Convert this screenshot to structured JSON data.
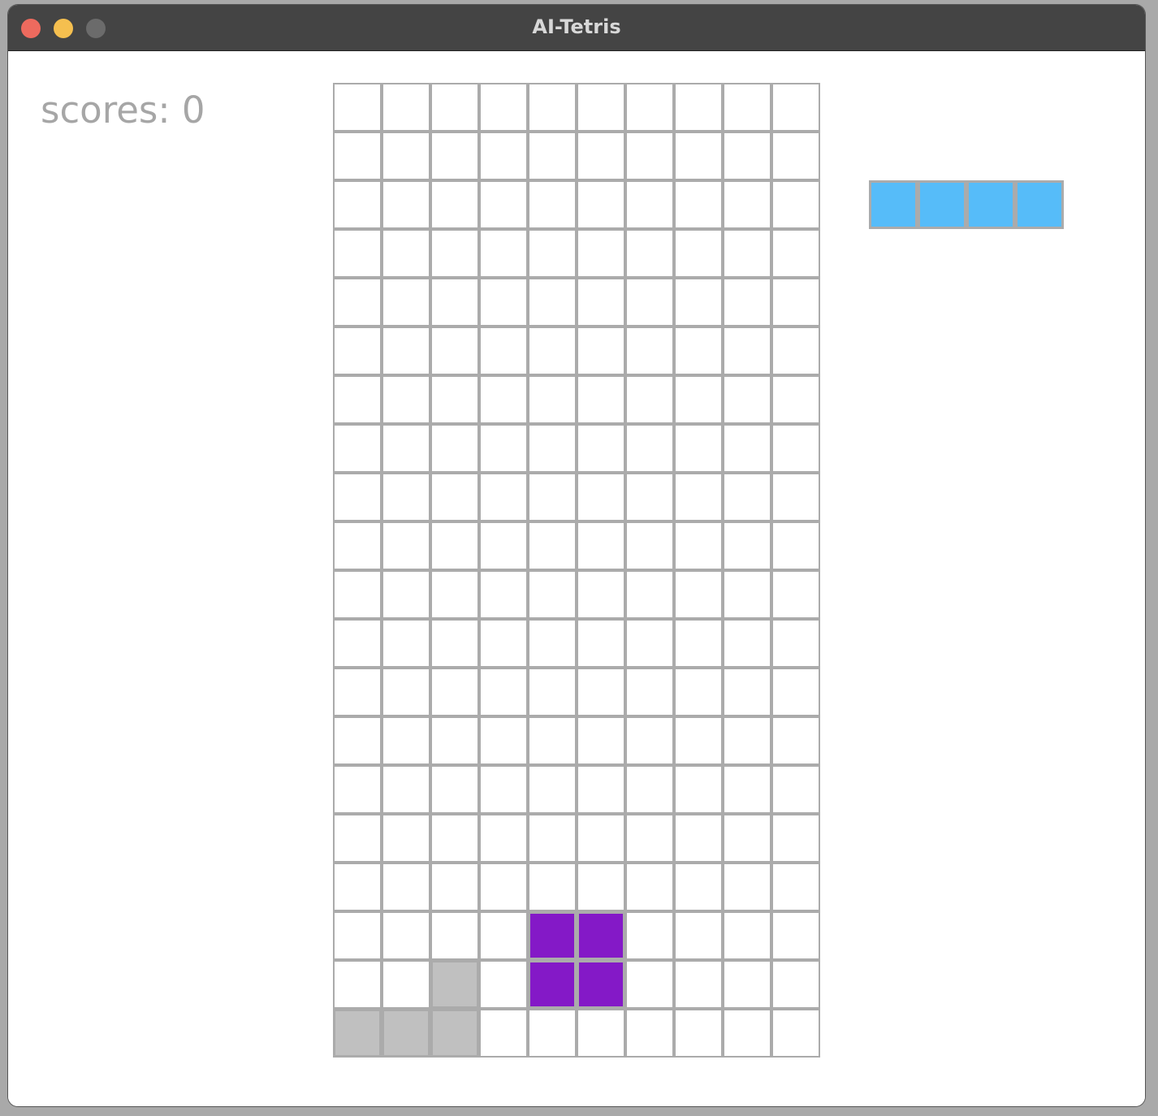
{
  "window": {
    "title": "AI-Tetris",
    "controls": {
      "close": {
        "icon": "close-dot-icon",
        "color": "#ed6a5e"
      },
      "minimize": {
        "icon": "minimize-dot-icon",
        "color": "#f5bf4f"
      },
      "zoom": {
        "icon": "zoom-dot-icon",
        "color": "#6b6b6b"
      }
    }
  },
  "score": {
    "label": "scores:",
    "value": "0"
  },
  "board": {
    "cols": 10,
    "rows": 20,
    "grid_color": "#ababab",
    "empty_color": "#ffffff",
    "filled_cells": [
      {
        "row": 17,
        "col": 4,
        "color": "#8419c7",
        "kind": "active"
      },
      {
        "row": 17,
        "col": 5,
        "color": "#8419c7",
        "kind": "active"
      },
      {
        "row": 18,
        "col": 4,
        "color": "#8419c7",
        "kind": "active"
      },
      {
        "row": 18,
        "col": 5,
        "color": "#8419c7",
        "kind": "active"
      },
      {
        "row": 18,
        "col": 2,
        "color": "#c0c0c0",
        "kind": "locked"
      },
      {
        "row": 19,
        "col": 0,
        "color": "#c0c0c0",
        "kind": "locked"
      },
      {
        "row": 19,
        "col": 1,
        "color": "#c0c0c0",
        "kind": "locked"
      },
      {
        "row": 19,
        "col": 2,
        "color": "#c0c0c0",
        "kind": "locked"
      }
    ]
  },
  "next_piece": {
    "shape": "I",
    "color": "#56bcf9",
    "blocks": [
      {
        "row": 0,
        "col": 0
      },
      {
        "row": 0,
        "col": 1
      },
      {
        "row": 0,
        "col": 2
      },
      {
        "row": 0,
        "col": 3
      }
    ]
  }
}
